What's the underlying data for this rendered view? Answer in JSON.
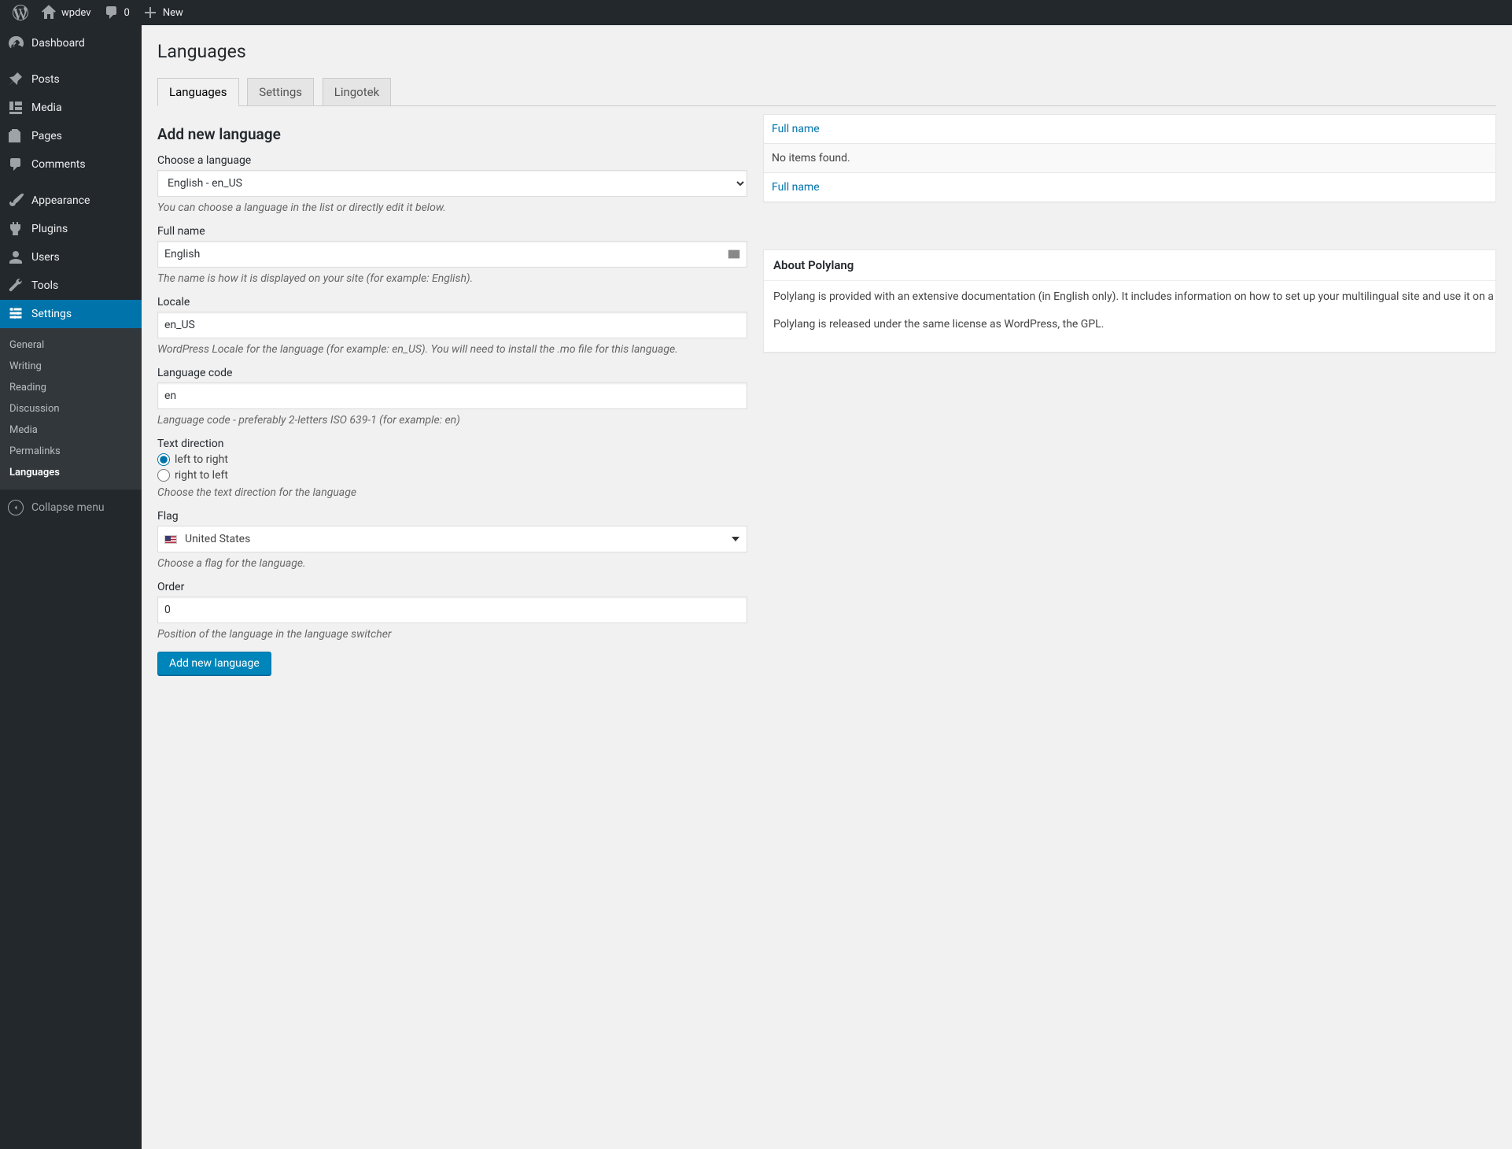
{
  "adminbar": {
    "site_name": "wpdev",
    "comments_count": "0",
    "new_label": "New"
  },
  "menu": {
    "dashboard": "Dashboard",
    "posts": "Posts",
    "media": "Media",
    "pages": "Pages",
    "comments": "Comments",
    "appearance": "Appearance",
    "plugins": "Plugins",
    "users": "Users",
    "tools": "Tools",
    "settings": "Settings",
    "collapse": "Collapse menu",
    "submenu": {
      "general": "General",
      "writing": "Writing",
      "reading": "Reading",
      "discussion": "Discussion",
      "media": "Media",
      "permalinks": "Permalinks",
      "languages": "Languages"
    }
  },
  "page": {
    "title": "Languages",
    "tabs": {
      "languages": "Languages",
      "settings": "Settings",
      "lingotek": "Lingotek"
    }
  },
  "form": {
    "heading": "Add new language",
    "choose_label": "Choose a language",
    "choose_value": "English - en_US",
    "choose_help": "You can choose a language in the list or directly edit it below.",
    "fullname_label": "Full name",
    "fullname_value": "English",
    "fullname_help": "The name is how it is displayed on your site (for example: English).",
    "locale_label": "Locale",
    "locale_value": "en_US",
    "locale_help": "WordPress Locale for the language (for example: en_US). You will need to install the .mo file for this language.",
    "code_label": "Language code",
    "code_value": "en",
    "code_help": "Language code - preferably 2-letters ISO 639-1 (for example: en)",
    "dir_label": "Text direction",
    "dir_ltr": "left to right",
    "dir_rtl": "right to left",
    "dir_help": "Choose the text direction for the language",
    "flag_label": "Flag",
    "flag_value": "United States",
    "flag_help": "Choose a flag for the language.",
    "order_label": "Order",
    "order_value": "0",
    "order_help": "Position of the language in the language switcher",
    "submit": "Add new language"
  },
  "table": {
    "header_fullname": "Full name",
    "empty": "No items found.",
    "footer_fullname": "Full name"
  },
  "about": {
    "title": "About Polylang",
    "p1": "Polylang is provided with an extensive documentation (in English only). It includes information on how to set up your multilingual site and use it on a daily basis, a FAQ, as well as a documentation for programmers to adapt their plugins and themes. Support and extra features are available with Polylang Pro.",
    "p2": "Polylang is released under the same license as WordPress, the GPL."
  }
}
